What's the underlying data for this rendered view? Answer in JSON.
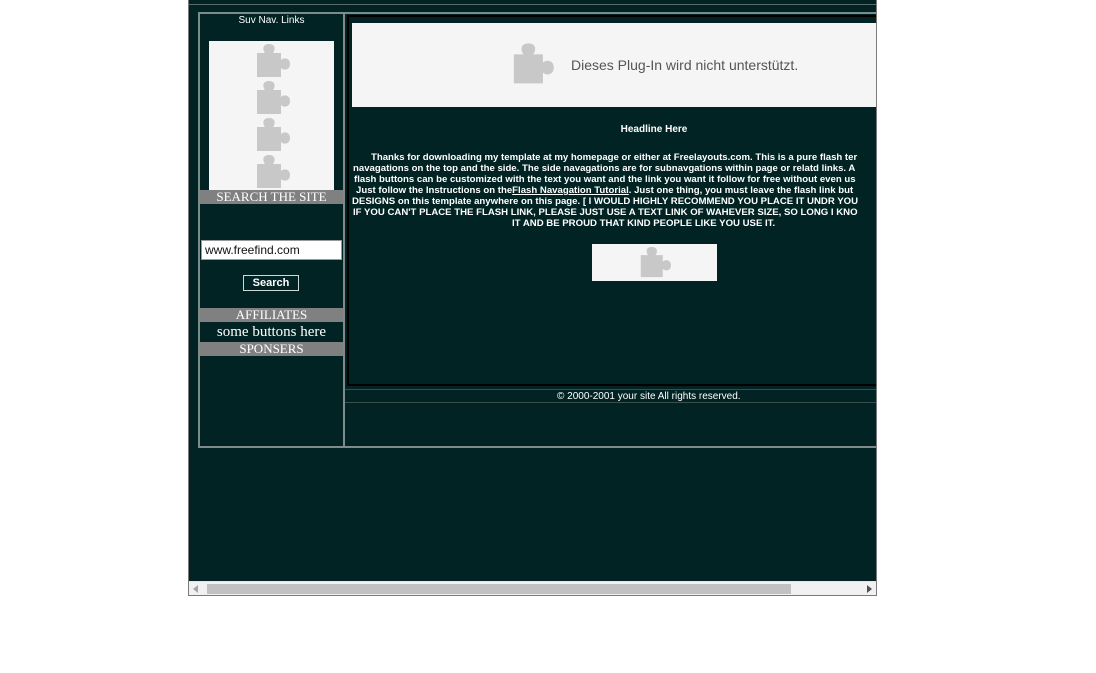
{
  "sidebar": {
    "title": "Suv Nav. Links",
    "search_heading": "SEARCH THE SITE",
    "search_value": "www.freefind.com",
    "search_button": "Search",
    "affiliates_heading": "AFFILIATES",
    "affiliates_text": "some buttons here",
    "sponsors_heading": "SPONSERS"
  },
  "content": {
    "plugin_message": "Dieses Plug-In wird nicht unterstützt.",
    "headline": "Headline Here",
    "body_lines": [
      "Thanks for downloading my template at my homepage or either at Freelayouts.com. This is a pure flash ter",
      "navagations on the top and the side. The side navagations are for subnavgations within page or relatd links. A",
      "flash buttons can be customized with the text you want and the link you want it follow for free without even us",
      "Just follow the Instructions on the",
      "Flash Navagation Tutorial",
      ". Just one thing, you must leave the flash link but",
      "DESIGNS on this template anywhere on this page. [ I WOULD HIGHLY RECOMMEND YOU PLACE IT UNDR YOU",
      "IF YOU CAN'T PLACE THE FLASH LINK, PLEASE JUST USE A TEXT LINK OF WAHEVER SIZE, SO LONG I KNO",
      "IT AND BE PROUD THAT KIND PEOPLE LIKE YOU USE IT."
    ],
    "copyright": "© 2000-2001 your site All rights reserved."
  },
  "colors": {
    "background": "#012323",
    "bar": "#808080",
    "plugin_bg": "#f5f5f5",
    "puzzle": "#c8c8c8"
  },
  "icons": {
    "plugin": "puzzle-piece-icon",
    "scroll_left": "arrow-left-icon",
    "scroll_right": "arrow-right-icon"
  }
}
